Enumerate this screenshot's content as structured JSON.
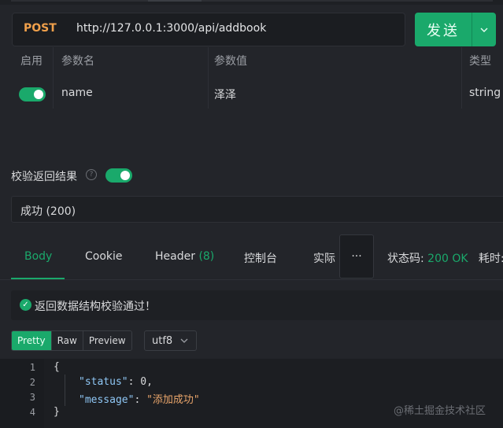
{
  "request": {
    "method": "POST",
    "url": "http://127.0.0.1:3000/api/addbook",
    "send_label": "发送"
  },
  "params": {
    "headers": [
      "启用",
      "参数名",
      "参数值",
      "类型"
    ],
    "rows": [
      {
        "enabled": true,
        "name": "name",
        "value": "泽泽",
        "type": "string"
      }
    ]
  },
  "validate": {
    "label": "校验返回结果",
    "help_icon": "question-icon",
    "enabled": true,
    "selected": "成功 (200)"
  },
  "tabs": {
    "body": "Body",
    "cookie": "Cookie",
    "header": "Header",
    "header_count": "(8)",
    "console": "控制台",
    "actual": "实际",
    "more": "···",
    "active": "Body"
  },
  "status": {
    "code_label": "状态码:",
    "code_value": "200 OK",
    "time_label": "耗时:"
  },
  "result": {
    "message": "返回数据结构校验通过！"
  },
  "format": {
    "options": [
      "Pretty",
      "Raw",
      "Preview"
    ],
    "selected": "Pretty",
    "encoding": "utf8"
  },
  "code": {
    "line_numbers": [
      "1",
      "2",
      "3",
      "4"
    ],
    "open_brace": "{",
    "status_key": "\"status\"",
    "status_value": "0",
    "message_key": "\"message\"",
    "message_value": "\"添加成功\"",
    "close_brace": "}"
  },
  "watermark": "@稀土掘金技术社区",
  "colors": {
    "accent": "#1aa96b",
    "method": "#f0a04b",
    "background": "#23252a"
  }
}
